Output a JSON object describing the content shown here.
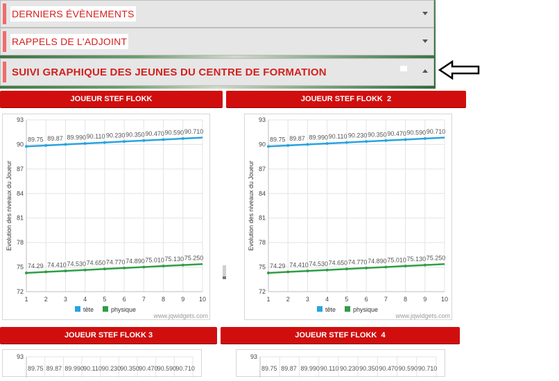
{
  "accordion": [
    {
      "label": "DERNIERS ÉVÈNEMENTS",
      "expanded": false
    },
    {
      "label": "RAPPELS DE L'ADJOINT",
      "expanded": false
    },
    {
      "label": "SUIVI GRAPHIQUE DES JEUNES DU CENTRE DE FORMATION",
      "expanded": true
    }
  ],
  "annotation_arrow_icon": "left-arrow-outline",
  "colors": {
    "accent_red": "#d10e0e",
    "label_red": "#d3201e",
    "series_head": "#29a3e0",
    "series_physique": "#2e9e45"
  },
  "panels": [
    {
      "header": "JOUEUR STEF FLOKK"
    },
    {
      "header": "JOUEUR STEF FLOKK  2"
    },
    {
      "header": "JOUEUR STEF FLOKK 3"
    },
    {
      "header": "JOUEUR STEF FLOKK  4"
    }
  ],
  "watermark": "www.jqwidgets.com",
  "chart_data": [
    {
      "type": "line",
      "x": [
        1,
        2,
        3,
        4,
        5,
        6,
        7,
        8,
        9,
        10
      ],
      "xlim": [
        1,
        10
      ],
      "ylim": [
        72,
        93
      ],
      "yticks": [
        72,
        75,
        78,
        81,
        84,
        87,
        90,
        93
      ],
      "ylabel": "Evolution des niveaux du Joueur",
      "grid": true,
      "legend_position": "bottom-center",
      "series": [
        {
          "name": "tête",
          "values": [
            89.75,
            89.87,
            89.99,
            90.11,
            90.23,
            90.35,
            90.47,
            90.59,
            90.71,
            90.83
          ],
          "labels": [
            "89.75",
            "89.87",
            "89.990",
            "90.110",
            "90.230",
            "90.350",
            "90.470",
            "90.590",
            "90.710"
          ]
        },
        {
          "name": "physique",
          "values": [
            74.29,
            74.41,
            74.53,
            74.65,
            74.77,
            74.89,
            75.01,
            75.13,
            75.25,
            75.37
          ],
          "labels": [
            "74.29",
            "74.410",
            "74.530",
            "74.650",
            "74.770",
            "74.890",
            "75.010",
            "75.130",
            "75.250"
          ]
        }
      ]
    },
    {
      "type": "line",
      "x": [
        1,
        2,
        3,
        4,
        5,
        6,
        7,
        8,
        9,
        10
      ],
      "xlim": [
        1,
        10
      ],
      "ylim": [
        72,
        93
      ],
      "yticks": [
        72,
        75,
        78,
        81,
        84,
        87,
        90,
        93
      ],
      "ylabel": "Evolution des niveaux du Joueur",
      "grid": true,
      "legend_position": "bottom-center",
      "series": [
        {
          "name": "tête",
          "values": [
            89.75,
            89.87,
            89.99,
            90.11,
            90.23,
            90.35,
            90.47,
            90.59,
            90.71,
            90.83
          ],
          "labels": [
            "89.75",
            "89.87",
            "89.990",
            "90.110",
            "90.230",
            "90.350",
            "90.470",
            "90.590",
            "90.710"
          ]
        },
        {
          "name": "physique",
          "values": [
            74.29,
            74.41,
            74.53,
            74.65,
            74.77,
            74.89,
            75.01,
            75.13,
            75.25,
            75.37
          ],
          "labels": [
            "74.29",
            "74.410",
            "74.530",
            "74.650",
            "74.770",
            "74.890",
            "75.010",
            "75.130",
            "75.250"
          ]
        }
      ]
    },
    {
      "type": "line",
      "partial": true,
      "visible_ytick": "93",
      "visible_labels": [
        "89.75",
        "89.87",
        "89.990",
        "90.110",
        "90.230",
        "90.350",
        "90.470",
        "90.590",
        "90.710"
      ]
    },
    {
      "type": "line",
      "partial": true,
      "visible_ytick": "93",
      "visible_labels": [
        "89.75",
        "89.87",
        "89.990",
        "90.110",
        "90.230",
        "90.350",
        "90.470",
        "90.590",
        "90.710"
      ]
    }
  ]
}
